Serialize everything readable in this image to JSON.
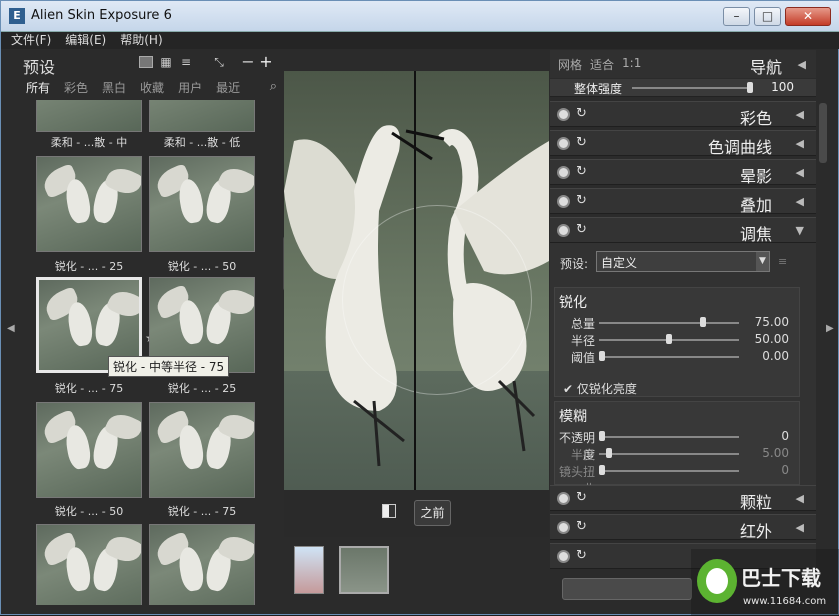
{
  "window": {
    "title": "Alien Skin Exposure 6",
    "icon_letter": "E",
    "min": "–",
    "max": "□",
    "close": "✕"
  },
  "menu": [
    "文件(F)",
    "编辑(E)",
    "帮助(H)"
  ],
  "presets": {
    "title": "预设",
    "categories": [
      "所有",
      "彩色",
      "黑白",
      "收藏",
      "用户",
      "最近"
    ],
    "active_category": "所有",
    "thumb_labels": [
      "柔和 - ...散 - 中",
      "柔和 - ...散 - 低",
      "锐化 - ... - 25",
      "锐化 - ... - 50",
      "锐化 - ... - 75",
      "锐化 - ... - 25",
      "锐化 - ... - 50",
      "锐化 - ... - 75"
    ],
    "tooltip": "锐化 - 中等半径 - 75"
  },
  "center": {
    "before_button": "之前"
  },
  "navigator": {
    "links": [
      "网格",
      "适合",
      "1:1"
    ],
    "title": "导航"
  },
  "strength": {
    "label": "整体强度",
    "value": "100"
  },
  "sections": [
    "彩色",
    "色调曲线",
    "晕影",
    "叠加",
    "调焦",
    "颗粒",
    "红外",
    ""
  ],
  "focus": {
    "preset_label": "预设:",
    "preset_value": "自定义",
    "sharpen": {
      "title": "锐化",
      "rows": [
        {
          "label": "总量",
          "value": "75.00",
          "level": 0.75
        },
        {
          "label": "半径",
          "value": "50.00",
          "level": 0.5
        },
        {
          "label": "阈值",
          "value": "0.00",
          "level": 0.0
        }
      ]
    },
    "check_label": "仅锐化亮度",
    "blur": {
      "title": "模糊",
      "rows": [
        {
          "label": "不透明度",
          "value": "0",
          "level": 0.0
        },
        {
          "label": "半径",
          "value": "5.00",
          "level": 0.05
        },
        {
          "label": "镜头扭曲",
          "value": "0",
          "level": 0.0
        }
      ]
    }
  },
  "watermark": {
    "line1": "巴士下载",
    "line2": "www.11684.com"
  }
}
